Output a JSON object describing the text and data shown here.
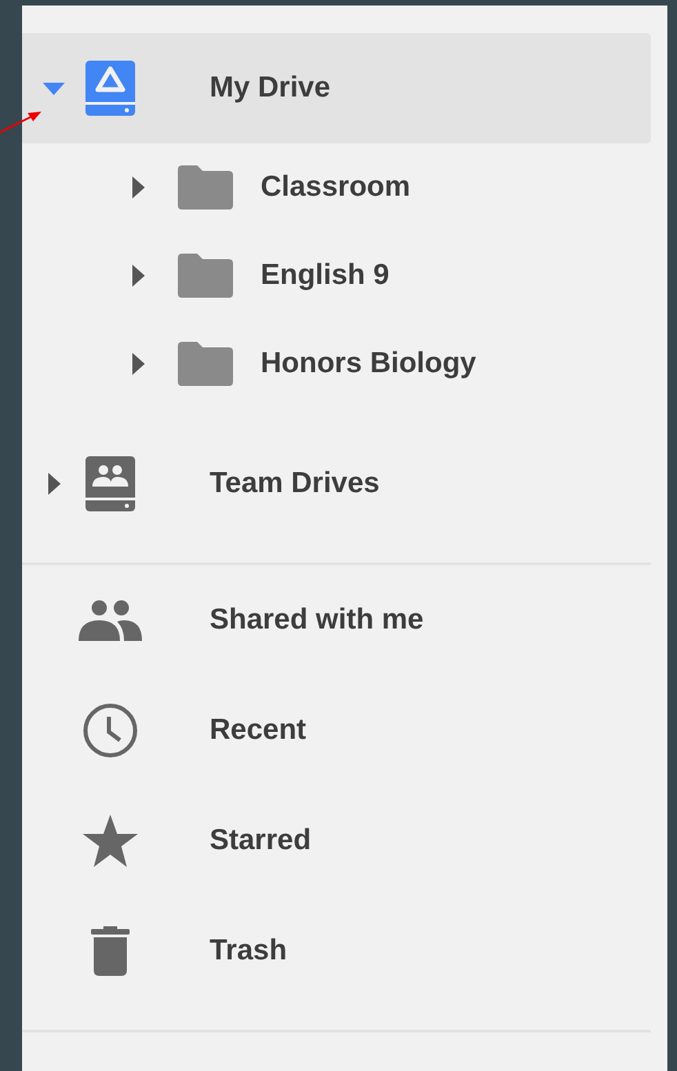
{
  "drives": [
    {
      "label": "My Drive",
      "kind": "my-drive",
      "expanded": true,
      "selected": true,
      "children": [
        {
          "label": "Classroom",
          "kind": "folder",
          "expanded": false,
          "selected": false
        },
        {
          "label": "English 9",
          "kind": "folder",
          "expanded": false,
          "selected": false
        },
        {
          "label": "Honors Biology",
          "kind": "folder",
          "expanded": false,
          "selected": false
        }
      ]
    },
    {
      "label": "Team Drives",
      "kind": "team-drives",
      "expanded": false,
      "selected": false
    }
  ],
  "nav": [
    {
      "label": "Shared with me",
      "kind": "shared",
      "selected": false
    },
    {
      "label": "Recent",
      "kind": "recent",
      "selected": false
    },
    {
      "label": "Starred",
      "kind": "starred",
      "selected": false
    },
    {
      "label": "Trash",
      "kind": "trash",
      "selected": false
    }
  ]
}
